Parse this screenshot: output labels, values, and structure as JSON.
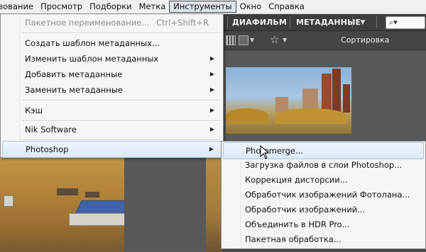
{
  "menubar": {
    "items": [
      "зование",
      "Просмотр",
      "Подборки",
      "Метка",
      "Инструменты",
      "Окно",
      "Справка"
    ]
  },
  "toolbar": {
    "tab_filmstrip": "ДИАФИЛЬМ",
    "tab_metadata": "МЕТАДАННЫЕ",
    "search_icon": "search-icon",
    "sort_label": "Сортировка Вручную"
  },
  "tools_menu": {
    "items": [
      {
        "label": "Пакетное переименование...",
        "shortcut": "Ctrl+Shift+R",
        "disabled": true
      },
      {
        "label": "Создать шаблон метаданных..."
      },
      {
        "label": "Изменить шаблон метаданных",
        "submenu": true
      },
      {
        "label": "Добавить метаданные",
        "submenu": true
      },
      {
        "label": "Заменить метаданные",
        "submenu": true
      },
      {
        "label": "Кэш",
        "submenu": true
      },
      {
        "label": "Nik Software",
        "submenu": true
      },
      {
        "label": "Photoshop",
        "submenu": true,
        "highlighted": true
      }
    ],
    "submenu_arrow": "▶"
  },
  "photoshop_submenu": {
    "items": [
      {
        "label": "Photomerge...",
        "highlighted": true
      },
      {
        "label": "Загрузка файлов в слои Photoshop..."
      },
      {
        "label": "Коррекция дисторсии..."
      },
      {
        "label": "Обработчик изображений Фотолана..."
      },
      {
        "label": "Обработчик изображений..."
      },
      {
        "label": "Объединить в HDR Pro..."
      },
      {
        "label": "Пакетная обработка..."
      }
    ]
  },
  "colors": {
    "highlight": "#dce9f7",
    "toolbar_bg": "#3d3d3d",
    "menu_bg": "#f5f5f5"
  }
}
